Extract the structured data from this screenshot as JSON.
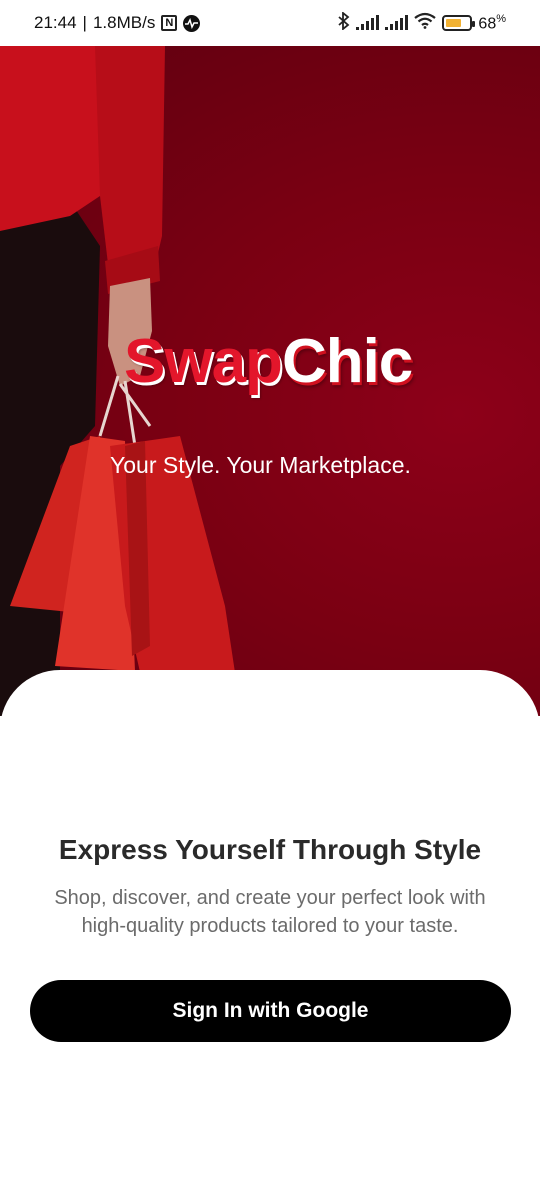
{
  "status_bar": {
    "time": "21:44",
    "separator": "|",
    "speed": "1.8MB/s",
    "battery_percent": "68",
    "battery_unit": "%",
    "battery_level": 0.68,
    "icons": [
      "nfc-icon",
      "pulse-icon",
      "bluetooth-icon",
      "signal-icon",
      "signal-icon",
      "wifi-icon",
      "battery-icon"
    ]
  },
  "hero": {
    "brand_part1": "Swap",
    "brand_part2": "Chic",
    "tagline": "Your Style. Your Marketplace."
  },
  "sheet": {
    "headline": "Express Yourself Through Style",
    "subtext": "Shop, discover, and create your perfect look with high-quality products tailored to your taste.",
    "button_label": "Sign In with Google"
  },
  "colors": {
    "hero_bg": "#7a0012",
    "brand_red": "#e3162b",
    "button_bg": "#000000",
    "battery_fill": "#f2b233"
  }
}
